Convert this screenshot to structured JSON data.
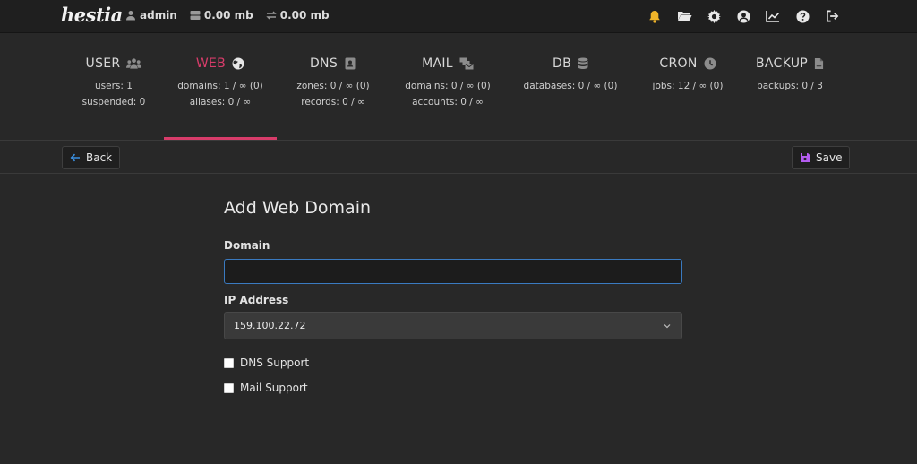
{
  "topbar": {
    "logo": "hestia",
    "user": "admin",
    "disk": "0.00 mb",
    "bandwidth": "0.00 mb"
  },
  "tabs": [
    {
      "name": "USER",
      "icon": "users-icon",
      "lines": [
        "users: 1",
        "suspended: 0"
      ]
    },
    {
      "name": "WEB",
      "icon": "globe-icon",
      "lines": [
        "domains: 1 / ∞ (0)",
        "aliases: 0 / ∞"
      ]
    },
    {
      "name": "DNS",
      "icon": "address-book-icon",
      "lines": [
        "zones: 0 / ∞ (0)",
        "records: 0 / ∞"
      ]
    },
    {
      "name": "MAIL",
      "icon": "mail-bulk-icon",
      "lines": [
        "domains: 0 / ∞ (0)",
        "accounts: 0 / ∞"
      ]
    },
    {
      "name": "DB",
      "icon": "database-icon",
      "lines": [
        "databases: 0 / ∞ (0)"
      ]
    },
    {
      "name": "CRON",
      "icon": "clock-icon",
      "lines": [
        "jobs: 12 / ∞ (0)"
      ]
    },
    {
      "name": "BACKUP",
      "icon": "file-icon",
      "lines": [
        "backups: 0 / 3"
      ]
    }
  ],
  "active_tab": "WEB",
  "toolbar": {
    "back_label": "Back",
    "save_label": "Save"
  },
  "form": {
    "title": "Add Web Domain",
    "domain_label": "Domain",
    "domain_value": "",
    "ip_label": "IP Address",
    "ip_value": "159.100.22.72",
    "dns_support_label": "DNS Support",
    "mail_support_label": "Mail Support"
  },
  "colors": {
    "accent": "#d83c6a",
    "bell": "#f0b429",
    "back_arrow": "#3a8fe0",
    "save_icon": "#b45cf0",
    "input_border": "#3a7ac0"
  }
}
